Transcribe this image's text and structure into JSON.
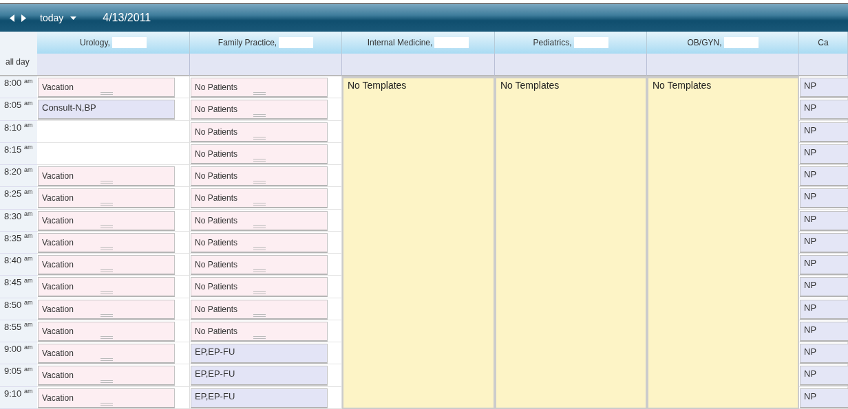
{
  "toolbar": {
    "today_label": "today",
    "date": "4/13/2011"
  },
  "all_day_label": "all day",
  "times": [
    "8:00 $^{am}$",
    "8:05 $^{am}$",
    "8:10 $^{am}$",
    "8:15 $^{am}$",
    "8:20 $^{am}$",
    "8:25 $^{am}$",
    "8:30 $^{am}$",
    "8:35 $^{am}$",
    "8:40 $^{am}$",
    "8:45 $^{am}$",
    "8:50 $^{am}$",
    "8:55 $^{am}$",
    "9:00 $^{am}$",
    "9:05 $^{am}$",
    "9:10 $^{am}$"
  ],
  "columns": [
    {
      "header": "Urology,",
      "redacted": true,
      "kind": "slots",
      "slots": [
        {
          "kind": "block",
          "text": "Vacation"
        },
        {
          "kind": "appointment",
          "text": "Consult-N,BP"
        },
        {
          "kind": "empty"
        },
        {
          "kind": "empty"
        },
        {
          "kind": "block",
          "text": "Vacation"
        },
        {
          "kind": "block",
          "text": "Vacation"
        },
        {
          "kind": "block",
          "text": "Vacation"
        },
        {
          "kind": "block",
          "text": "Vacation"
        },
        {
          "kind": "block",
          "text": "Vacation"
        },
        {
          "kind": "block",
          "text": "Vacation"
        },
        {
          "kind": "block",
          "text": "Vacation"
        },
        {
          "kind": "block",
          "text": "Vacation"
        },
        {
          "kind": "block",
          "text": "Vacation"
        },
        {
          "kind": "block",
          "text": "Vacation"
        },
        {
          "kind": "block",
          "text": "Vacation"
        }
      ]
    },
    {
      "header": "Family Practice,",
      "redacted": true,
      "kind": "slots",
      "slots": [
        {
          "kind": "block",
          "text": "No Patients"
        },
        {
          "kind": "block",
          "text": "No Patients"
        },
        {
          "kind": "block",
          "text": "No Patients"
        },
        {
          "kind": "block",
          "text": "No Patients"
        },
        {
          "kind": "block",
          "text": "No Patients"
        },
        {
          "kind": "block",
          "text": "No Patients"
        },
        {
          "kind": "block",
          "text": "No Patients"
        },
        {
          "kind": "block",
          "text": "No Patients"
        },
        {
          "kind": "block",
          "text": "No Patients"
        },
        {
          "kind": "block",
          "text": "No Patients"
        },
        {
          "kind": "block",
          "text": "No Patients"
        },
        {
          "kind": "block",
          "text": "No Patients"
        },
        {
          "kind": "appointment",
          "text": "EP,EP-FU"
        },
        {
          "kind": "appointment",
          "text": "EP,EP-FU"
        },
        {
          "kind": "appointment",
          "text": "EP,EP-FU"
        }
      ]
    },
    {
      "header": "Internal Medicine,",
      "redacted": true,
      "kind": "template",
      "text": "No Templates"
    },
    {
      "header": "Pediatrics,",
      "redacted": true,
      "kind": "template",
      "text": "No Templates"
    },
    {
      "header": "OB/GYN,",
      "redacted": true,
      "kind": "template",
      "text": "No Templates"
    },
    {
      "header": "Ca",
      "redacted": false,
      "kind": "slots",
      "slots": [
        {
          "kind": "np",
          "text": "NP"
        },
        {
          "kind": "np",
          "text": "NP"
        },
        {
          "kind": "np",
          "text": "NP"
        },
        {
          "kind": "np",
          "text": "NP"
        },
        {
          "kind": "np",
          "text": "NP"
        },
        {
          "kind": "np",
          "text": "NP"
        },
        {
          "kind": "np",
          "text": "NP"
        },
        {
          "kind": "np",
          "text": "NP"
        },
        {
          "kind": "np",
          "text": "NP"
        },
        {
          "kind": "np",
          "text": "NP"
        },
        {
          "kind": "np",
          "text": "NP"
        },
        {
          "kind": "np",
          "text": "NP"
        },
        {
          "kind": "np",
          "text": "NP"
        },
        {
          "kind": "np",
          "text": "NP"
        },
        {
          "kind": "np",
          "text": "NP"
        }
      ]
    }
  ]
}
